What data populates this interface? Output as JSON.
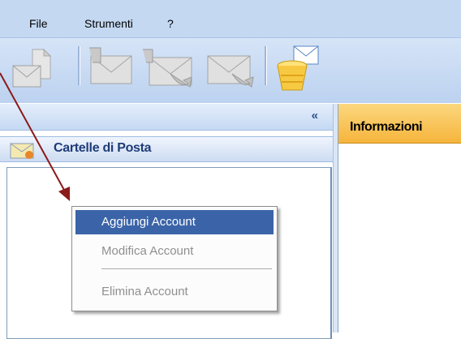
{
  "menubar": {
    "items": [
      {
        "label": "File"
      },
      {
        "label": "Strumenti"
      },
      {
        "label": "?"
      }
    ]
  },
  "toolbar": {
    "buttons": [
      {
        "icon": "new-message-icon",
        "enabled": false
      },
      {
        "icon": "reply-icon",
        "enabled": false
      },
      {
        "icon": "reply-all-icon",
        "enabled": false
      },
      {
        "icon": "forward-icon",
        "enabled": false
      },
      {
        "icon": "empty-trash-icon",
        "enabled": true
      }
    ]
  },
  "left_panel": {
    "collapse_label": "«",
    "folders_title": "Cartelle di Posta"
  },
  "right_panel": {
    "tab_title": "Informazioni"
  },
  "context_menu": {
    "items": [
      {
        "label": "Aggiungi Account",
        "state": "highlighted"
      },
      {
        "label": "Modifica Account",
        "state": "disabled"
      },
      {
        "label": "Elimina Account",
        "state": "disabled"
      }
    ]
  },
  "colors": {
    "menubar_bg": "#c4d8f2",
    "selection": "#3b64a8",
    "info_tab": "#f6b53c",
    "arrow": "#8b1a1a"
  }
}
